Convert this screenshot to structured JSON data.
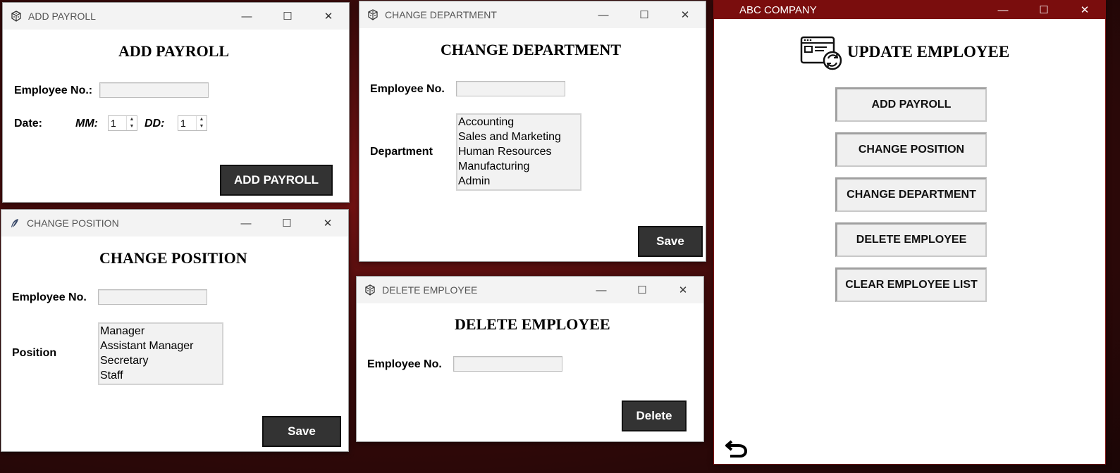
{
  "add_payroll": {
    "title": "ADD PAYROLL",
    "heading": "ADD PAYROLL",
    "employee_label": "Employee No.:",
    "employee_value": "",
    "date_label": "Date:",
    "mm_label": "MM:",
    "mm_value": "1",
    "dd_label": "DD:",
    "dd_value": "1",
    "button": "ADD PAYROLL"
  },
  "change_position": {
    "title": "CHANGE POSITION",
    "heading": "CHANGE POSITION",
    "employee_label": "Employee No.",
    "employee_value": "",
    "position_label": "Position",
    "positions": [
      "Manager",
      "Assistant Manager",
      "Secretary",
      "Staff"
    ],
    "button": "Save"
  },
  "change_department": {
    "title": "CHANGE DEPARTMENT",
    "heading": "CHANGE DEPARTMENT",
    "employee_label": "Employee No.",
    "employee_value": "",
    "department_label": "Department",
    "departments": [
      "Accounting",
      "Sales and Marketing",
      "Human Resources",
      "Manufacturing",
      "Admin"
    ],
    "button": "Save"
  },
  "delete_employee": {
    "title": "DELETE EMPLOYEE",
    "heading": "DELETE EMPLOYEE",
    "employee_label": "Employee No.",
    "employee_value": "",
    "button": "Delete"
  },
  "abc": {
    "title": "ABC COMPANY",
    "heading": "UPDATE EMPLOYEE",
    "buttons": [
      "ADD PAYROLL",
      "CHANGE POSITION",
      "CHANGE DEPARTMENT",
      "DELETE EMPLOYEE",
      "CLEAR EMPLOYEE LIST"
    ],
    "title_color": "#7a0d0d"
  },
  "icons": {
    "app": "dice-icon",
    "feather": "feather-icon",
    "minimize": "minimize-icon",
    "maximize": "maximize-icon",
    "close": "close-icon",
    "update": "update-employee-icon",
    "back": "back-arrow-icon"
  }
}
